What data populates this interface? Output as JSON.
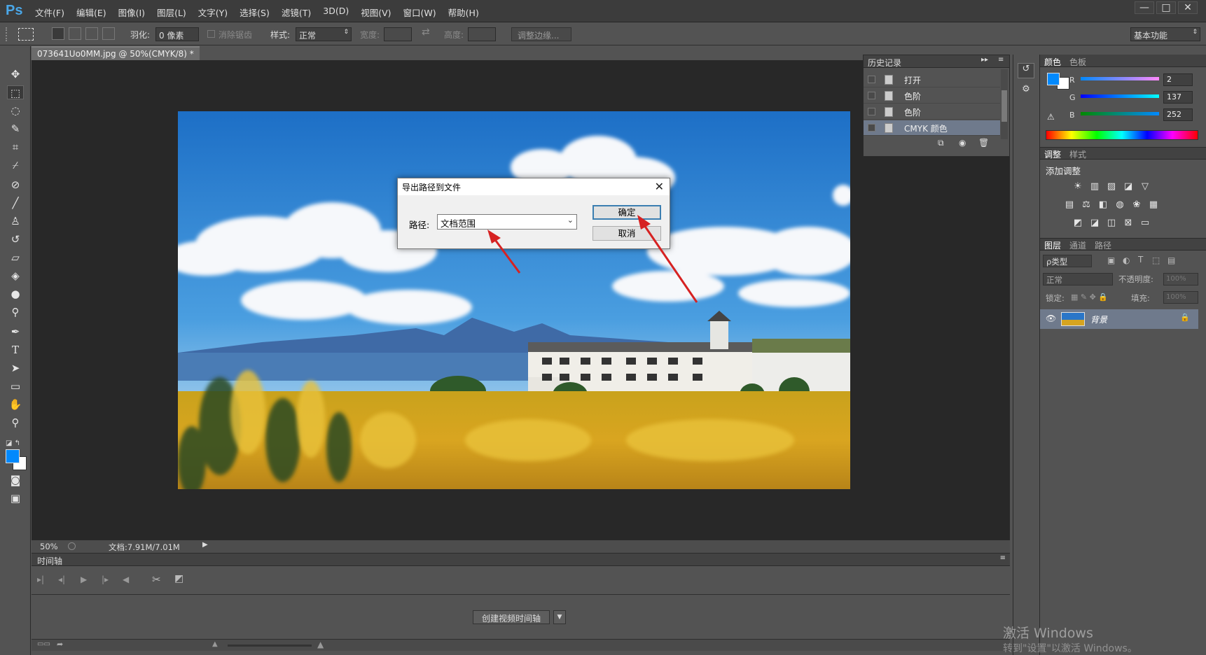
{
  "app": {
    "logo": "Ps"
  },
  "menu": [
    "文件(F)",
    "编辑(E)",
    "图像(I)",
    "图层(L)",
    "文字(Y)",
    "选择(S)",
    "滤镜(T)",
    "3D(D)",
    "视图(V)",
    "窗口(W)",
    "帮助(H)"
  ],
  "window_controls": {
    "minimize": "—",
    "maximize": "□",
    "close": "✕"
  },
  "options": {
    "feather_label": "羽化:",
    "feather_value": "0 像素",
    "antialias_label": "消除锯齿",
    "style_label": "样式:",
    "style_value": "正常",
    "width_label": "宽度:",
    "height_label": "高度:",
    "refine_edge": "调整边缘...",
    "workspace": "基本功能"
  },
  "document": {
    "tab_title": "073641Uo0MM.jpg @ 50%(CMYK/8) *",
    "tab_close": "×",
    "zoom": "50%",
    "doc_info": "文档:7.91M/7.01M"
  },
  "timeline": {
    "title": "时间轴",
    "create_button": "创建视频时间轴"
  },
  "history": {
    "title": "历史记录",
    "items": [
      "打开",
      "色阶",
      "色阶",
      "CMYK 颜色"
    ]
  },
  "color_panel": {
    "tabs": [
      "颜色",
      "色板"
    ],
    "channels": [
      {
        "label": "R",
        "value": "2"
      },
      {
        "label": "G",
        "value": "137"
      },
      {
        "label": "B",
        "value": "252"
      }
    ],
    "foreground": "#0289fc",
    "background": "#ffffff"
  },
  "adjust_panel": {
    "tabs": [
      "调整",
      "样式"
    ],
    "add_label": "添加调整"
  },
  "layers_panel": {
    "tabs": [
      "图层",
      "通道",
      "路径"
    ],
    "filter_label": "ρ类型",
    "blend_mode": "正常",
    "opacity_label": "不透明度:",
    "opacity_value": "100%",
    "lock_label": "锁定:",
    "fill_label": "填充:",
    "fill_value": "100%",
    "layer_name": "背景"
  },
  "dialog": {
    "title": "导出路径到文件",
    "path_label": "路径:",
    "path_value": "文档范围",
    "ok": "确定",
    "cancel": "取消"
  },
  "watermark": {
    "line1": "激活 Windows",
    "line2": "转到\"设置\"以激活 Windows。"
  }
}
